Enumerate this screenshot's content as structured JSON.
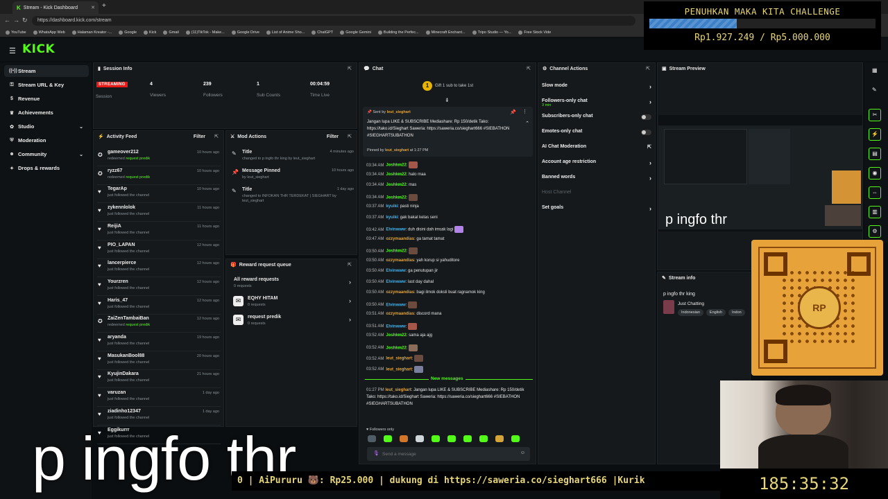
{
  "browser": {
    "tab_title": "Stream - Kick Dashboard",
    "url": "https://dashboard.kick.com/stream",
    "bookmarks": [
      "YouTube",
      "WhatsApp Web",
      "Halaman Kreator -...",
      "Google",
      "Kick",
      "Gmail",
      "(11)TikTok - Make...",
      "Google Drive",
      "List of Anime Sho...",
      "ChatGPT",
      "Google Gemini",
      "Building the Perfec...",
      "Minecraft Enchant...",
      "Tripo Studio — Yo...",
      "Free Stock Vide"
    ]
  },
  "brand": {
    "logo": "KICK",
    "accent": "#53fc18"
  },
  "sidebar": {
    "items": [
      {
        "label": "Stream",
        "icon": "broadcast-icon"
      },
      {
        "label": "Stream URL & Key",
        "icon": "key-icon"
      },
      {
        "label": "Revenue",
        "icon": "dollar-icon"
      },
      {
        "label": "Achievements",
        "icon": "trophy-icon"
      },
      {
        "label": "Studio",
        "icon": "palette-icon"
      },
      {
        "label": "Moderation",
        "icon": "shield-icon"
      },
      {
        "label": "Community",
        "icon": "people-icon"
      },
      {
        "label": "Drops & rewards",
        "icon": "gift-icon"
      }
    ]
  },
  "session": {
    "title": "Session Info",
    "status": "STREAMING",
    "status_label": "Session",
    "stats": [
      {
        "value": "4",
        "label": "Viewers"
      },
      {
        "value": "239",
        "label": "Followers"
      },
      {
        "value": "1",
        "label": "Sub Counts"
      },
      {
        "value": "00:04:59",
        "label": "Time Live"
      }
    ]
  },
  "activity": {
    "title": "Activity Feed",
    "filter": "Filter",
    "rows": [
      {
        "name": "gameover212",
        "sub": "redeemed",
        "highlight": "request predik",
        "time": "10 hours ago",
        "icon": "reward-icon"
      },
      {
        "name": "ryzz67",
        "sub": "redeemed",
        "highlight": "request predik",
        "time": "10 hours ago",
        "icon": "reward-icon"
      },
      {
        "name": "TegarAp",
        "sub": "just followed the channel",
        "highlight": "",
        "time": "10 hours ago",
        "icon": "heart-icon"
      },
      {
        "name": "zykennlolok",
        "sub": "just followed the channel",
        "highlight": "",
        "time": "11 hours ago",
        "icon": "heart-icon"
      },
      {
        "name": "ReijiA",
        "sub": "just followed the channel",
        "highlight": "",
        "time": "11 hours ago",
        "icon": "heart-icon"
      },
      {
        "name": "PIO_LAPAN",
        "sub": "just followed the channel",
        "highlight": "",
        "time": "12 hours ago",
        "icon": "heart-icon"
      },
      {
        "name": "lancerpierce",
        "sub": "just followed the channel",
        "highlight": "",
        "time": "12 hours ago",
        "icon": "heart-icon"
      },
      {
        "name": "Yourzren",
        "sub": "just followed the channel",
        "highlight": "",
        "time": "12 hours ago",
        "icon": "heart-icon"
      },
      {
        "name": "Haris_47",
        "sub": "just followed the channel",
        "highlight": "",
        "time": "12 hours ago",
        "icon": "heart-icon"
      },
      {
        "name": "ZaiZenTambaiBan",
        "sub": "redeemed",
        "highlight": "request predik",
        "time": "12 hours ago",
        "icon": "reward-icon"
      },
      {
        "name": "aryanda",
        "sub": "just followed the channel",
        "highlight": "",
        "time": "19 hours ago",
        "icon": "heart-icon"
      },
      {
        "name": "MasukanBool88",
        "sub": "just followed the channel",
        "highlight": "",
        "time": "20 hours ago",
        "icon": "heart-icon"
      },
      {
        "name": "KyujinDakara",
        "sub": "just followed the channel",
        "highlight": "",
        "time": "21 hours ago",
        "icon": "heart-icon"
      },
      {
        "name": "varuzan",
        "sub": "just followed the channel",
        "highlight": "",
        "time": "1 day ago",
        "icon": "heart-icon"
      },
      {
        "name": "ziadinho12347",
        "sub": "just followed the channel",
        "highlight": "",
        "time": "1 day ago",
        "icon": "heart-icon"
      },
      {
        "name": "Eggikurrr",
        "sub": "just followed the channel",
        "highlight": "",
        "time": "",
        "icon": "heart-icon"
      }
    ]
  },
  "mod": {
    "title": "Mod Actions",
    "filter": "Filter",
    "rows": [
      {
        "title": "Title",
        "time": "4 minutes ago",
        "desc": "changed to p ingfo thr king by leut_sieghart",
        "icon": "pencil-icon"
      },
      {
        "title": "Message Pinned",
        "time": "10 hours ago",
        "desc": "by leut_sieghart",
        "icon": "pin-icon"
      },
      {
        "title": "Title",
        "time": "1 day ago",
        "desc": "changed to INFOKAN THR TERDEKAT | SIEGHART by leut_sieghart",
        "icon": "pencil-icon"
      }
    ]
  },
  "rewards": {
    "title": "Reward request queue",
    "items": [
      {
        "title": "All reward requests",
        "desc": "0 requests",
        "icon": ""
      },
      {
        "title": "EQHY HITAM",
        "desc": "0 requests",
        "icon": "ticket-icon"
      },
      {
        "title": "request predik",
        "desc": "0 requests",
        "icon": "ticket-icon"
      }
    ]
  },
  "chat": {
    "title": "Chat",
    "gift_prompt": "Gift 1 sub to take 1st",
    "pinned": {
      "sent_by_label": "Sent by",
      "sent_by": "leut_sieghart",
      "text": "Jangan lupa LIKE & SUBSCRIBE Mediashare: Rp 150/detik Tako: https://tako.id/Sieghart Saweria: https://saweria.co/sieghart666 #SIEBATHON #SIEGHARTSUBATHON",
      "pinned_by_label": "Pinned by",
      "pinned_by": "leut_sieghart",
      "pinned_at": "at 1:27 PM"
    },
    "messages": [
      {
        "time": "03:34 AM",
        "user": "Joshkm22",
        "color": "#53fc18",
        "text": "",
        "emote": true
      },
      {
        "time": "03:34 AM",
        "user": "Joshkm22",
        "color": "#53fc18",
        "text": "halo maa",
        "emote": false
      },
      {
        "time": "03:34 AM",
        "user": "Joshkm22",
        "color": "#53fc18",
        "text": "mas",
        "emote": false
      },
      {
        "time": "03:34 AM",
        "user": "Joshkm22",
        "color": "#53fc18",
        "text": "",
        "emote": true
      },
      {
        "time": "03:37 AM",
        "user": "kyuiki",
        "color": "#3db5f0",
        "text": "pasti ninja",
        "emote": false
      },
      {
        "time": "03:37 AM",
        "user": "kyuiki",
        "color": "#3db5f0",
        "text": "gak bakal kelas seni",
        "emote": false
      },
      {
        "time": "03:42 AM",
        "user": "Elvinwww",
        "color": "#3db5f0",
        "text": "duh disini dah imsak lagi",
        "emote": true
      },
      {
        "time": "03:47 AM",
        "user": "ozzymaandias",
        "color": "#e3a53a",
        "text": "ga tamat tamat",
        "emote": false
      },
      {
        "time": "03:50 AM",
        "user": "Joshkm22",
        "color": "#53fc18",
        "text": "",
        "emote": true
      },
      {
        "time": "03:50 AM",
        "user": "ozzymaandias",
        "color": "#e3a53a",
        "text": "yah korup si yahuditore",
        "emote": false
      },
      {
        "time": "03:50 AM",
        "user": "Elvinwww",
        "color": "#3db5f0",
        "text": "ga penutupan jir",
        "emote": false
      },
      {
        "time": "03:50 AM",
        "user": "Elvinwww",
        "color": "#3db5f0",
        "text": "last day dahal",
        "emote": false
      },
      {
        "time": "03:50 AM",
        "user": "ozzymaandias",
        "color": "#e3a53a",
        "text": "bagi ilmok doksli buat ragnamok king",
        "emote": false
      },
      {
        "time": "03:50 AM",
        "user": "Elvinwww",
        "color": "#3db5f0",
        "text": "",
        "emote": true
      },
      {
        "time": "03:51 AM",
        "user": "ozzymaandias",
        "color": "#e3a53a",
        "text": "discord mana",
        "emote": false
      },
      {
        "time": "03:51 AM",
        "user": "Elvinwww",
        "color": "#3db5f0",
        "text": "",
        "emote": true
      },
      {
        "time": "03:52 AM",
        "user": "Joshkm22",
        "color": "#53fc18",
        "text": "sama aja ajg",
        "emote": false
      },
      {
        "time": "03:52 AM",
        "user": "Joshkm22",
        "color": "#53fc18",
        "text": "",
        "emote": true
      },
      {
        "time": "03:52 AM",
        "user": "leut_sieghart",
        "color": "#e3a53a",
        "text": "",
        "emote": true
      },
      {
        "time": "03:52 AM",
        "user": "leut_sieghart",
        "color": "#e3a53a",
        "text": "",
        "emote": true
      }
    ],
    "new_messages_label": "New messages",
    "last": {
      "time": "01:27 PM",
      "user": "leut_sieghart",
      "text": "Jangan lupa LIKE & SUBSCRIBE Mediashare: Rp 150/detik Tako: https://tako.id/Sieghart Saweria: https://saweria.co/sieghart666 #SIEBATHON #SIEGHARTSUBATHON"
    },
    "followers_only": "Followers only",
    "input_placeholder": "Send a message"
  },
  "channel_actions": {
    "title": "Channel Actions",
    "items": [
      {
        "label": "Slow mode",
        "sub": "",
        "control": "chevron"
      },
      {
        "label": "Followers-only chat",
        "sub": "3 min",
        "control": "chevron"
      },
      {
        "label": "Subscribers-only chat",
        "sub": "",
        "control": "toggle"
      },
      {
        "label": "Emotes-only chat",
        "sub": "",
        "control": "toggle"
      },
      {
        "label": "AI Chat Moderation",
        "sub": "",
        "control": "external"
      },
      {
        "label": "Account age restriction",
        "sub": "",
        "control": "chevron"
      },
      {
        "label": "Banned words",
        "sub": "",
        "control": "chevron"
      },
      {
        "label": "Host Channel",
        "sub": "",
        "control": "disabled"
      },
      {
        "label": "Set goals",
        "sub": "",
        "control": "chevron"
      }
    ]
  },
  "preview": {
    "title": "Stream Preview",
    "caption": "p ingfo thr"
  },
  "stream_info": {
    "title": "Stream info",
    "stream_title": "p ingfo thr king",
    "category": "Just Chatting",
    "tags": [
      "Indonesian",
      "English",
      "Indon"
    ]
  },
  "overlay": {
    "challenge_title": "PENUHKAN MAKA KITA CHALLENGE",
    "challenge_progress": 0.385,
    "challenge_amount": "Rp1.927.249 / Rp5.000.000",
    "caption": "p ingfo thr",
    "ticker": "0 | AiPururu 🐻: Rp25.000 |  dukung di https://saweria.co/sieghart666 |Kurik",
    "timer": "185:35:32",
    "qr_badge": "RP"
  }
}
